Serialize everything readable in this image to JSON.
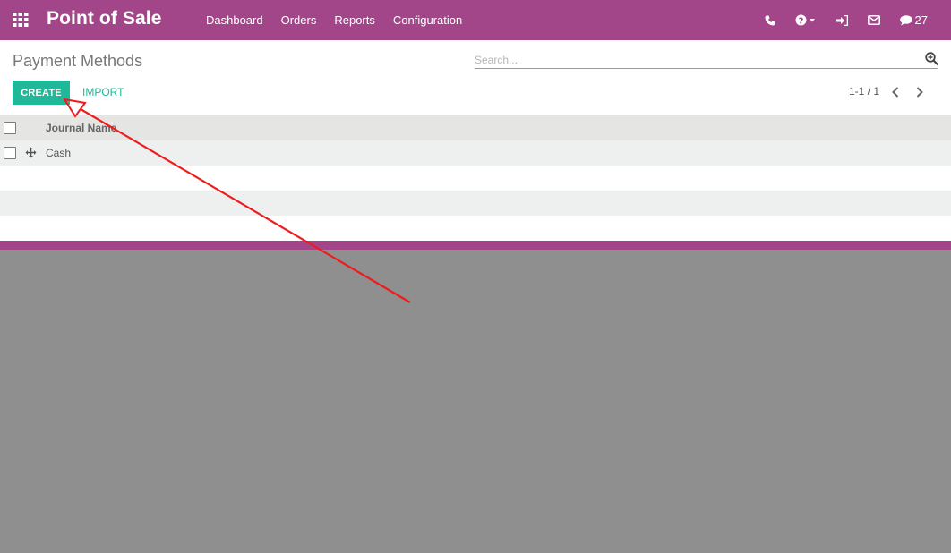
{
  "navbar": {
    "brand": "Point of Sale",
    "menu": [
      "Dashboard",
      "Orders",
      "Reports",
      "Configuration"
    ],
    "chat_count": "27",
    "icons": [
      "apps-grid-icon",
      "phone-icon",
      "help-icon",
      "sign-in-icon",
      "envelope-icon",
      "chat-icon"
    ]
  },
  "control": {
    "title": "Payment Methods",
    "search_placeholder": "Search...",
    "create_label": "CREATE",
    "import_label": "IMPORT",
    "pager": "1-1 / 1"
  },
  "list": {
    "column_header": "Journal Name",
    "rows": [
      {
        "name": "Cash"
      }
    ]
  },
  "colors": {
    "brand": "#a24689",
    "primary": "#21b799",
    "annotation_arrow": "#ee1c1c"
  }
}
